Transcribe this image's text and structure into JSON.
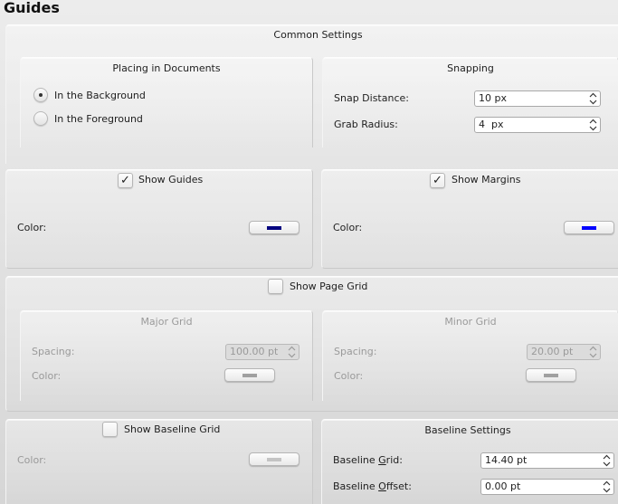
{
  "page": {
    "title": "Guides"
  },
  "common_settings": {
    "title": "Common Settings",
    "placing": {
      "title": "Placing in Documents",
      "options": [
        {
          "label": "In the Background",
          "selected": true
        },
        {
          "label": "In the Foreground",
          "selected": false
        }
      ]
    },
    "snapping": {
      "title": "Snapping",
      "snap_distance": {
        "label": "Snap Distance:",
        "value": "10 px"
      },
      "grab_radius": {
        "label": "Grab Radius:",
        "value": "4  px"
      }
    }
  },
  "show_guides": {
    "label": "Show Guides",
    "checked": true,
    "check_glyph": "✓",
    "color_label": "Color:",
    "color": "#00007f"
  },
  "show_margins": {
    "label": "Show Margins",
    "checked": true,
    "check_glyph": "✓",
    "color_label": "Color:",
    "color": "#0000ff"
  },
  "page_grid": {
    "label": "Show Page Grid",
    "checked": false,
    "major": {
      "title": "Major Grid",
      "spacing_label": "Spacing:",
      "spacing_value": "100.00 pt",
      "color_label": "Color:",
      "color": "#a0a0a0"
    },
    "minor": {
      "title": "Minor Grid",
      "spacing_label": "Spacing:",
      "spacing_value": "20.00 pt",
      "color_label": "Color:",
      "color": "#a0a0a0"
    }
  },
  "baseline_grid": {
    "label": "Show Baseline Grid",
    "checked": false,
    "color_label": "Color:",
    "color": "#c4c4c4"
  },
  "baseline_settings": {
    "title": "Baseline Settings",
    "grid": {
      "label_prefix": "Baseline ",
      "label_mnemonic": "G",
      "label_suffix": "rid:",
      "value": "14.40 pt"
    },
    "offset": {
      "label_prefix": "Baseline ",
      "label_mnemonic": "O",
      "label_suffix": "ffset:",
      "value": "0.00 pt"
    }
  }
}
